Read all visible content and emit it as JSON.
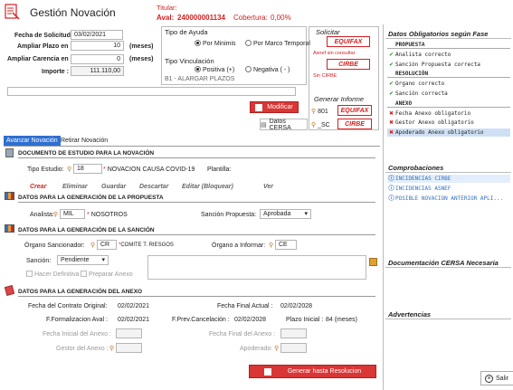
{
  "header": {
    "title": "Gestión Novación",
    "titular_label": "Titular:",
    "aval_label": "Aval:",
    "aval_value": "240000001134",
    "cobertura_label": "Cobertura:",
    "cobertura_value": "0,00%"
  },
  "form": {
    "fecha_solicitud_label": "Fecha de Solicitud :",
    "fecha_solicitud_value": "03/02/2021",
    "ampliar_plazo_label": "Ampliar Plazo en :",
    "ampliar_plazo_value": "10",
    "ampliar_plazo_unit": "(meses)",
    "ampliar_carencia_label": "Ampliar Carencia en :",
    "ampliar_carencia_value": "0",
    "ampliar_carencia_unit": "(meses)",
    "importe_label": "Importe :",
    "importe_value": "111.110,00"
  },
  "ayuda": {
    "title": "Tipo de Ayuda",
    "opt1": "Por Minimis",
    "opt2": "Por Marco Temporal",
    "vinc_title": "Tipo Vinculación",
    "vinc_opt1": "Positiva (+)",
    "vinc_opt2": "Negativa ( - )",
    "vinc_detail": "B1 - ALARGAR PLAZOS"
  },
  "solicitar": {
    "title": "Solicitar",
    "equifax": "EQUIFAX",
    "equifax_note": "Asnef sin consultar",
    "cirbe": "CIRBE",
    "cirbe_note": "Sin CIRBE",
    "generar_title": "Generar Informe",
    "gen_equifax_code": "801",
    "gen_equifax": "EQUIFAX",
    "gen_cirbe_code": "_SC",
    "gen_cirbe": "CIRBE"
  },
  "buttons": {
    "modificar": "Modificar",
    "datos_cersa": "Datos CERSA",
    "generar_resolucion": "Generar hasta Resolucion",
    "salir": "Salir"
  },
  "tabs": {
    "avanzar": "Avanzar Novación",
    "retirar": "Retirar Novación"
  },
  "doc_estudio": {
    "heading": "DOCUMENTO DE ESTUDIO PARA LA NOVACIÓN",
    "tipo_label": "Tipo Estudio:",
    "tipo_code": "18",
    "tipo_desc": "NOVACION CAUSA COVID-19",
    "plantilla_label": "Plantilla:",
    "actions": [
      "Crear",
      "Eliminar",
      "Guardar",
      "Descartar",
      "Editar (Bloquear)",
      "Ver"
    ]
  },
  "propuesta": {
    "heading": "DATOS PARA LA GENERACIÓN DE LA PROPUESTA",
    "analista_label": "Analista:",
    "analista_code": "MIL",
    "analista_name": "NOSOTROS",
    "sancion_label": "Sanción Propuesta:",
    "sancion_value": "Aprobada"
  },
  "sancion": {
    "heading": "DATOS PARA LA GENERACIÓN DE LA SANCIÓN",
    "organo_label": "Órgano Sancionador:",
    "organo_code": "CR",
    "organo_name": "COMITE T.  RIESGOS",
    "informar_label": "Órgano a Informar:",
    "informar_code": "CE",
    "sancion_label": "Sanción:",
    "sancion_value": "Pendiente",
    "hacer_definitiva": "Hacer Definitiva",
    "preparar_anexo": "Preparar Anexo"
  },
  "anexo": {
    "heading": "DATOS PARA LA GENERACIÓN DEL ANEXO",
    "fecha_contrato_label": "Fecha del Contrato Original:",
    "fecha_contrato_value": "02/02/2021",
    "fecha_final_label": "Fecha Final Actual :",
    "fecha_final_value": "02/02/2028",
    "formalizacion_label": "F.Formalizacion Aval :",
    "formalizacion_value": "02/02/2021",
    "prev_cancel_label": "F.Prev.Cancelación :",
    "prev_cancel_value": "02/02/2028",
    "plazo_label": "Plazo Inicial :",
    "plazo_value": "84 (meses)",
    "fecha_inicial_anexo_label": "Fecha Inicial del Anexo :",
    "fecha_final_anexo_label": "Fecha Final del Anexo :",
    "gestor_label": "Gestor del Anexo :",
    "apoderado_label": "Apoderado:"
  },
  "right_panel": {
    "title": "Datos Obligatorios según Fase",
    "rows": [
      {
        "text": "PROPUESTA",
        "icon": "",
        "kind": "head"
      },
      {
        "text": "Analista correcto",
        "icon": "✔",
        "kind": "ok"
      },
      {
        "text": "Sanción Propuesta correcta",
        "icon": "✔",
        "kind": "ok"
      },
      {
        "text": "RESOLUCIÓN",
        "icon": "",
        "kind": "head"
      },
      {
        "text": "Organo correcto",
        "icon": "✔",
        "kind": "ok"
      },
      {
        "text": "Sanción correcta",
        "icon": "✔",
        "kind": "ok"
      },
      {
        "text": "ANEXO",
        "icon": "",
        "kind": "head"
      },
      {
        "text": "Fecha Anexo obligatorio",
        "icon": "✖",
        "kind": "err"
      },
      {
        "text": "Gestor Anexo obligatorio",
        "icon": "✖",
        "kind": "err"
      },
      {
        "text": "Apoderado Anexo obligatorio",
        "icon": "✖",
        "kind": "err"
      }
    ],
    "comprobaciones_title": "Comprobaciones",
    "comprobaciones": [
      "INCIDENCIAS CIRBE",
      "INCIDENCIAS ASNEF",
      "POSIBLE NOVACION ANTERIOR APLI..."
    ],
    "doc_cersa_title": "Documentación CERSA Necesaria",
    "advertencias_title": "Advertencias"
  }
}
